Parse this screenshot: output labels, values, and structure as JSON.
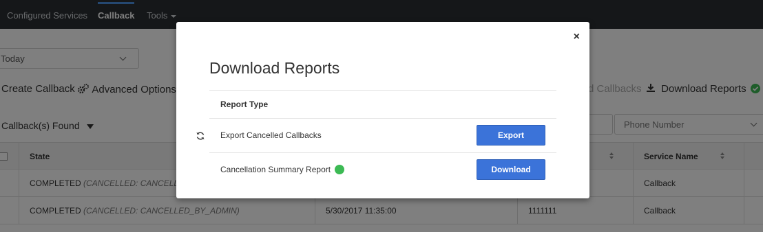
{
  "nav": {
    "items": [
      "Configured Services",
      "Callback",
      "Tools"
    ],
    "active": "Callback"
  },
  "filters": {
    "date_range": "Today",
    "phone_placeholder": "Phone Number"
  },
  "toolbar": {
    "create_callback": "Create Callback",
    "advanced_options": "Advanced Options",
    "cancelled_callbacks_partial": "d Callbacks",
    "download_reports": "Download Reports"
  },
  "results": {
    "found_label": "Callback(s) Found"
  },
  "table": {
    "headers": {
      "state": "State",
      "service_name": "Service Name"
    },
    "rows": [
      {
        "state": "COMPLETED",
        "state_detail": "(CANCELLED: CANCELLED_",
        "date": "",
        "phone": "",
        "service": "Callback"
      },
      {
        "state": "COMPLETED",
        "state_detail": "(CANCELLED: CANCELLED_BY_ADMIN)",
        "date": "5/30/2017 11:35:00",
        "phone": "1111111",
        "service": "Callback"
      }
    ]
  },
  "modal": {
    "title": "Download Reports",
    "close": "×",
    "column_header": "Report Type",
    "reports": [
      {
        "label": "Export Cancelled Callbacks",
        "button": "Export",
        "icon": "refresh-icon"
      },
      {
        "label": "Cancellation Summary Report",
        "button": "Download",
        "icon": "check-circle-icon"
      }
    ]
  },
  "colors": {
    "navbar": "#2b2f33",
    "primary_button": "#3b73d9",
    "success": "#3cba54",
    "overlay": "rgba(0,0,0,0.5)"
  }
}
